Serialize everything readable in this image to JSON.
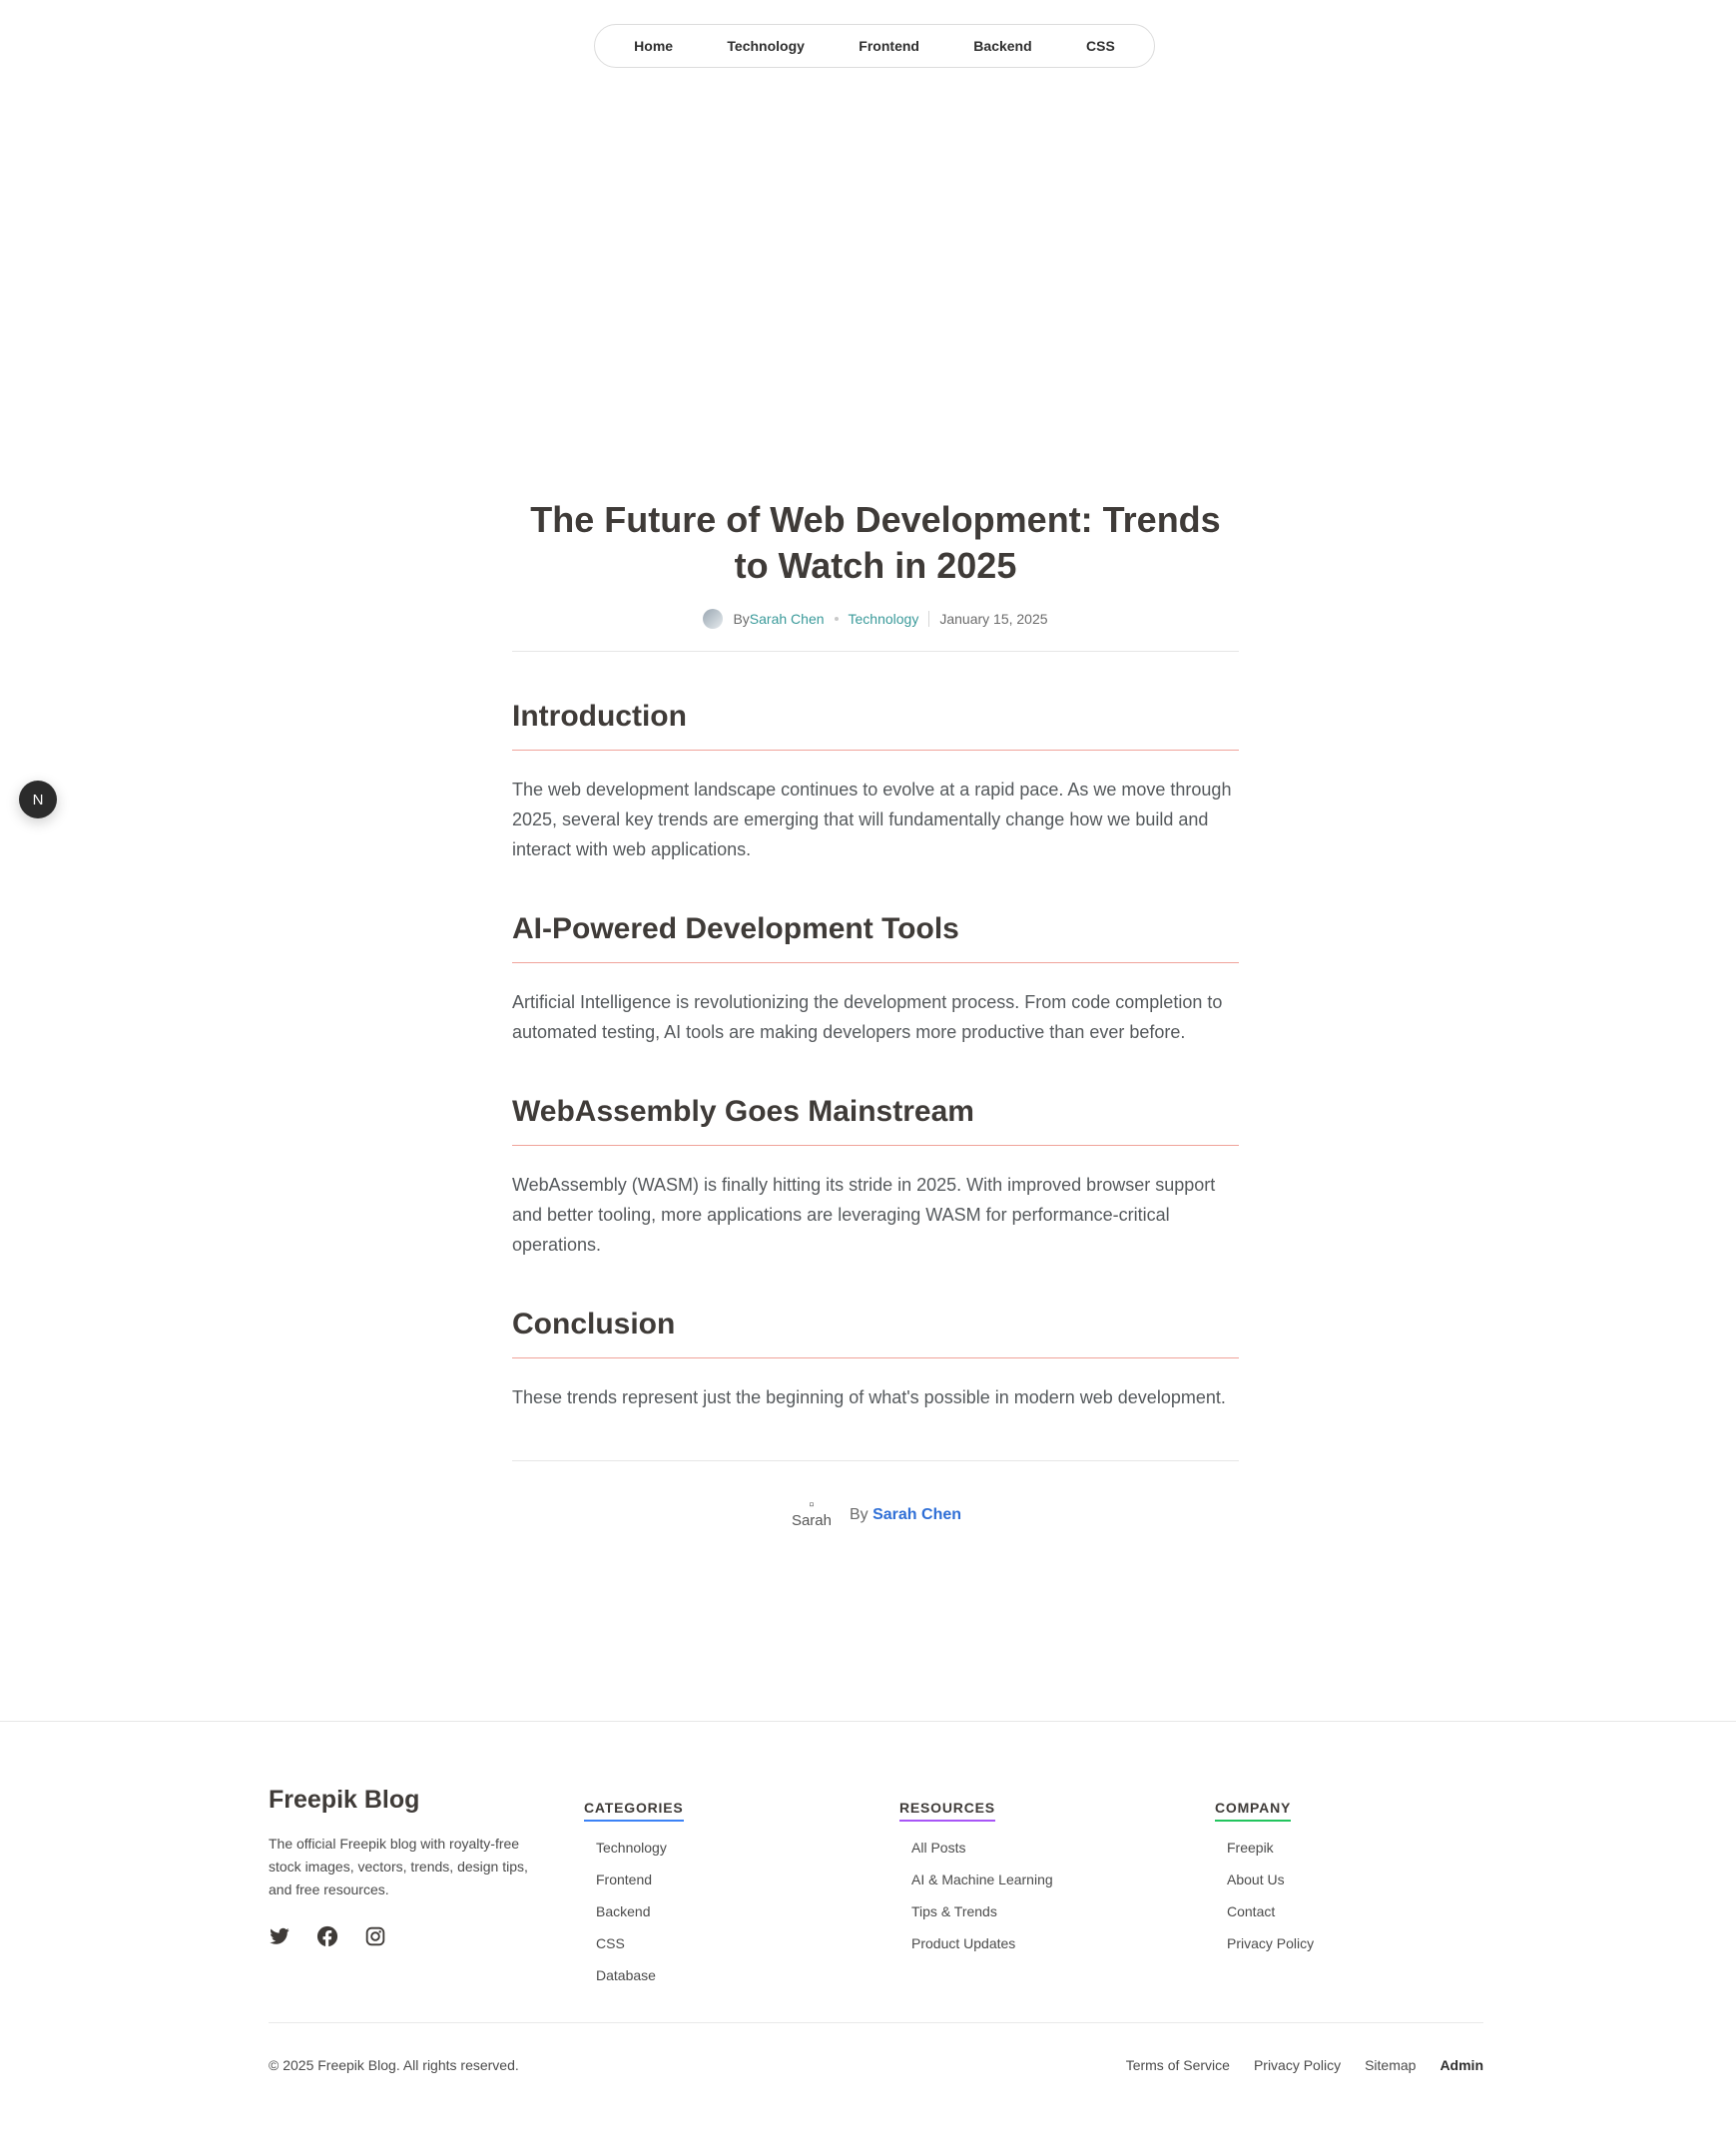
{
  "nav": {
    "items": [
      "Home",
      "Technology",
      "Frontend",
      "Backend",
      "CSS"
    ]
  },
  "floating_button": {
    "label": "N"
  },
  "article": {
    "title": "The Future of Web Development: Trends to Watch in 2025",
    "meta": {
      "by": "By",
      "author": "Sarah Chen",
      "category": "Technology",
      "date": "January 15, 2025"
    },
    "sections": [
      {
        "heading": "Introduction",
        "body": "The web development landscape continues to evolve at a rapid pace. As we move through 2025, several key trends are emerging that will fundamentally change how we build and interact with web applications."
      },
      {
        "heading": "AI-Powered Development Tools",
        "body": "Artificial Intelligence is revolutionizing the development process. From code completion to automated testing, AI tools are making developers more productive than ever before."
      },
      {
        "heading": "WebAssembly Goes Mainstream",
        "body": "WebAssembly (WASM) is finally hitting its stride in 2025. With improved browser support and better tooling, more applications are leveraging WASM for performance-critical operations."
      },
      {
        "heading": "Conclusion",
        "body": "These trends represent just the beginning of what's possible in modern web development."
      }
    ],
    "byline": {
      "avatar_alt": "Sarah",
      "by": "By",
      "author": "Sarah Chen"
    }
  },
  "footer": {
    "brand": {
      "title": "Freepik Blog",
      "description": "The official Freepik blog with royalty-free stock images, vectors, trends, design tips, and free resources."
    },
    "socials": [
      "twitter-icon",
      "facebook-icon",
      "instagram-icon"
    ],
    "columns": [
      {
        "title": "CATEGORIES",
        "accent": "#3b82f6",
        "items": [
          "Technology",
          "Frontend",
          "Backend",
          "CSS",
          "Database"
        ]
      },
      {
        "title": "RESOURCES",
        "accent": "#a855f7",
        "items": [
          "All Posts",
          "AI & Machine Learning",
          "Tips & Trends",
          "Product Updates"
        ]
      },
      {
        "title": "COMPANY",
        "accent": "#22c55e",
        "items": [
          "Freepik",
          "About Us",
          "Contact",
          "Privacy Policy"
        ]
      }
    ],
    "copyright": "© 2025 Freepik Blog. All rights reserved.",
    "bottom_links": [
      "Terms of Service",
      "Privacy Policy",
      "Sitemap",
      "Admin"
    ]
  },
  "colors": {
    "accent_teal": "#3a9a9a",
    "heading_underline": "#f0a39a",
    "author_link": "#2f6fd6"
  }
}
